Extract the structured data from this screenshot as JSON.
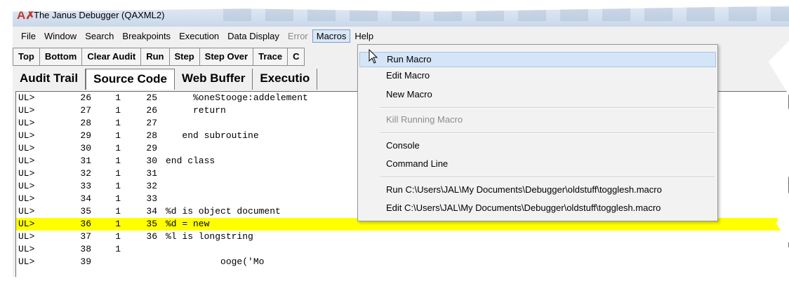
{
  "window": {
    "title": "The Janus Debugger (QAXML2)"
  },
  "menubar": {
    "file": "File",
    "window": "Window",
    "search": "Search",
    "breakpoints": "Breakpoints",
    "execution": "Execution",
    "data_display": "Data Display",
    "error": "Error",
    "macros": "Macros",
    "help": "Help"
  },
  "toolbar": {
    "top": "Top",
    "bottom": "Bottom",
    "clear_audit": "Clear Audit",
    "run": "Run",
    "step": "Step",
    "step_over": "Step Over",
    "trace": "Trace",
    "c": "C"
  },
  "tabs": {
    "audit_trail": "Audit Trail",
    "source_code": "Source Code",
    "web_buffer": "Web Buffer",
    "execution": "Executio"
  },
  "code_lines": [
    {
      "ul": "UL>",
      "line": "26",
      "depth": "1",
      "src": "25",
      "text": "     %oneStooge:addelement"
    },
    {
      "ul": "UL>",
      "line": "27",
      "depth": "1",
      "src": "26",
      "text": "     return"
    },
    {
      "ul": "UL>",
      "line": "28",
      "depth": "1",
      "src": "27",
      "text": ""
    },
    {
      "ul": "UL>",
      "line": "29",
      "depth": "1",
      "src": "28",
      "text": "   end subroutine"
    },
    {
      "ul": "UL>",
      "line": "30",
      "depth": "1",
      "src": "29",
      "text": ""
    },
    {
      "ul": "UL>",
      "line": "31",
      "depth": "1",
      "src": "30",
      "text": "end class"
    },
    {
      "ul": "UL>",
      "line": "32",
      "depth": "1",
      "src": "31",
      "text": ""
    },
    {
      "ul": "UL>",
      "line": "33",
      "depth": "1",
      "src": "32",
      "text": ""
    },
    {
      "ul": "UL>",
      "line": "34",
      "depth": "1",
      "src": "33",
      "text": ""
    },
    {
      "ul": "UL>",
      "line": "35",
      "depth": "1",
      "src": "34",
      "text": "%d is object document"
    },
    {
      "ul": "UL>",
      "line": "36",
      "depth": "1",
      "src": "35",
      "text": "%d = new"
    },
    {
      "ul": "UL>",
      "line": "37",
      "depth": "1",
      "src": "36",
      "text": "%l is longstring"
    },
    {
      "ul": "UL>",
      "line": "38",
      "depth": "1",
      "src": "",
      "text": ""
    },
    {
      "ul": "UL>",
      "line": "39",
      "depth": "",
      "src": "",
      "text": "          ooge('Mo"
    }
  ],
  "highlighted_line": "36",
  "macros_menu": {
    "run_macro": "Run Macro",
    "edit_macro": "Edit Macro",
    "new_macro": "New Macro",
    "kill_running_macro": "Kill Running Macro",
    "console": "Console",
    "command_line": "Command Line",
    "run_recent": "Run C:\\Users\\JAL\\My Documents\\Debugger\\oldstuff\\togglesh.macro",
    "edit_recent": "Edit C:\\Users\\JAL\\My Documents\\Debugger\\oldstuff\\togglesh.macro"
  },
  "colors": {
    "highlight": "#ffff00",
    "menu_hover": "#d5e5f8",
    "app_icon": "#c0392b"
  },
  "icons": {
    "app": "janus-debugger-icon",
    "cursor": "mouse-pointer-icon"
  }
}
